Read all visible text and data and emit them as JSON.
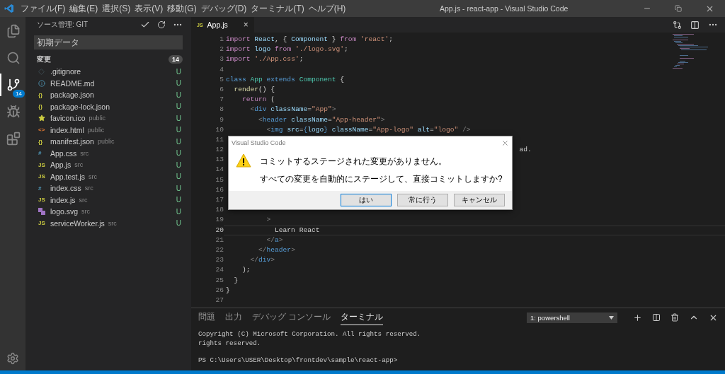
{
  "window": {
    "title": "App.js - react-app - Visual Studio Code"
  },
  "menu": [
    "ファイル(F)",
    "編集(E)",
    "選択(S)",
    "表示(V)",
    "移動(G)",
    "デバッグ(D)",
    "ターミナル(T)",
    "ヘルプ(H)"
  ],
  "activity_bar": [
    {
      "kind": "files",
      "selected": false
    },
    {
      "kind": "search",
      "selected": false
    },
    {
      "kind": "scm",
      "selected": true,
      "badge": "14"
    },
    {
      "kind": "debug",
      "selected": false
    },
    {
      "kind": "extensions",
      "selected": false
    }
  ],
  "sidebar": {
    "title": "ソース管理: GIT",
    "commit_message": "初期データ",
    "section": {
      "label": "変更",
      "count": "14"
    },
    "files": [
      {
        "kind": "git",
        "name": ".gitignore",
        "status": "U"
      },
      {
        "kind": "info",
        "name": "README.md",
        "status": "U"
      },
      {
        "kind": "json",
        "glyph": "{}",
        "name": "package.json",
        "status": "U"
      },
      {
        "kind": "json",
        "glyph": "{}",
        "name": "package-lock.json",
        "status": "U"
      },
      {
        "kind": "star",
        "name": "favicon.ico",
        "folder": "public",
        "status": "U"
      },
      {
        "kind": "html",
        "glyph": "<>",
        "name": "index.html",
        "folder": "public",
        "status": "U"
      },
      {
        "kind": "json",
        "glyph": "{}",
        "name": "manifest.json",
        "folder": "public",
        "status": "U"
      },
      {
        "kind": "css",
        "glyph": "#",
        "name": "App.css",
        "folder": "src",
        "status": "U"
      },
      {
        "kind": "js",
        "glyph": "JS",
        "name": "App.js",
        "folder": "src",
        "status": "U"
      },
      {
        "kind": "js",
        "glyph": "JS",
        "name": "App.test.js",
        "folder": "src",
        "status": "U"
      },
      {
        "kind": "css",
        "glyph": "#",
        "name": "index.css",
        "folder": "src",
        "status": "U"
      },
      {
        "kind": "js",
        "glyph": "JS",
        "name": "index.js",
        "folder": "src",
        "status": "U"
      },
      {
        "kind": "svg",
        "name": "logo.svg",
        "folder": "src",
        "status": "U"
      },
      {
        "kind": "js",
        "glyph": "JS",
        "name": "serviceWorker.js",
        "folder": "src",
        "status": "U"
      }
    ]
  },
  "tabs": [
    {
      "glyph": "JS",
      "label": "App.js",
      "close": "×",
      "selected": true
    }
  ],
  "editor": {
    "lines": [
      {
        "number": "1",
        "current": false,
        "tokens": [
          {
            "kind": "kw",
            "t": "import "
          },
          {
            "kind": "var",
            "t": "React"
          },
          {
            "kind": "p",
            "t": ", { "
          },
          {
            "kind": "var",
            "t": "Component"
          },
          {
            "kind": "p",
            "t": " } "
          },
          {
            "kind": "kw",
            "t": "from "
          },
          {
            "kind": "str",
            "t": "'react'"
          },
          {
            "kind": "p",
            "t": ";"
          }
        ]
      },
      {
        "number": "2",
        "current": false,
        "tokens": [
          {
            "kind": "kw",
            "t": "import "
          },
          {
            "kind": "var",
            "t": "logo "
          },
          {
            "kind": "kw",
            "t": "from "
          },
          {
            "kind": "str",
            "t": "'./logo.svg'"
          },
          {
            "kind": "p",
            "t": ";"
          }
        ]
      },
      {
        "number": "3",
        "current": false,
        "tokens": [
          {
            "kind": "kw",
            "t": "import "
          },
          {
            "kind": "str",
            "t": "'./App.css'"
          },
          {
            "kind": "p",
            "t": ";"
          }
        ]
      },
      {
        "number": "4",
        "current": false
      },
      {
        "number": "5",
        "current": false,
        "tokens": [
          {
            "kind": "decl",
            "t": "class "
          },
          {
            "kind": "type",
            "t": "App "
          },
          {
            "kind": "decl",
            "t": "extends "
          },
          {
            "kind": "type",
            "t": "Component "
          },
          {
            "kind": "p",
            "t": "{"
          }
        ]
      },
      {
        "number": "6",
        "current": false,
        "tokens": [
          {
            "kind": "fn",
            "t": "  render"
          },
          {
            "kind": "p",
            "t": "() {"
          }
        ]
      },
      {
        "number": "7",
        "current": false,
        "tokens": [
          {
            "kind": "kw",
            "t": "    return "
          },
          {
            "kind": "p",
            "t": "("
          }
        ]
      },
      {
        "number": "8",
        "current": false,
        "tokens": [
          {
            "kind": "tag",
            "t": "      <"
          },
          {
            "kind": "decl",
            "t": "div "
          },
          {
            "kind": "var",
            "t": "className"
          },
          {
            "kind": "p",
            "t": "="
          },
          {
            "kind": "str",
            "t": "\"App\""
          },
          {
            "kind": "tag",
            "t": ">"
          }
        ]
      },
      {
        "number": "9",
        "current": false,
        "tokens": [
          {
            "kind": "tag",
            "t": "        <"
          },
          {
            "kind": "decl",
            "t": "header "
          },
          {
            "kind": "var",
            "t": "className"
          },
          {
            "kind": "p",
            "t": "="
          },
          {
            "kind": "str",
            "t": "\"App-header\""
          },
          {
            "kind": "tag",
            "t": ">"
          }
        ]
      },
      {
        "number": "10",
        "current": false,
        "tokens": [
          {
            "kind": "tag",
            "t": "          <"
          },
          {
            "kind": "decl",
            "t": "img "
          },
          {
            "kind": "var",
            "t": "src"
          },
          {
            "kind": "p",
            "t": "="
          },
          {
            "kind": "decl",
            "t": "{"
          },
          {
            "kind": "var",
            "t": "logo"
          },
          {
            "kind": "decl",
            "t": "} "
          },
          {
            "kind": "var",
            "t": "className"
          },
          {
            "kind": "p",
            "t": "="
          },
          {
            "kind": "str",
            "t": "\"App-logo\" "
          },
          {
            "kind": "var",
            "t": "alt"
          },
          {
            "kind": "p",
            "t": "="
          },
          {
            "kind": "str",
            "t": "\"logo\" "
          },
          {
            "kind": "tag",
            "t": "/>"
          }
        ]
      },
      {
        "number": "11",
        "current": false
      },
      {
        "number": "12",
        "current": false,
        "tokens": [
          {
            "kind": "p",
            "t": "                                                                        ad."
          }
        ]
      },
      {
        "number": "13",
        "current": false
      },
      {
        "number": "14",
        "current": false
      },
      {
        "number": "15",
        "current": false
      },
      {
        "number": "16",
        "current": false
      },
      {
        "number": "17",
        "current": false
      },
      {
        "number": "18",
        "current": false
      },
      {
        "number": "19",
        "current": false,
        "tokens": [
          {
            "kind": "tag",
            "t": "          >"
          }
        ]
      },
      {
        "number": "20",
        "current": true,
        "tokens": [
          {
            "kind": "p",
            "t": "            Learn React"
          }
        ]
      },
      {
        "number": "21",
        "current": false,
        "tokens": [
          {
            "kind": "tag",
            "t": "          </"
          },
          {
            "kind": "decl",
            "t": "a"
          },
          {
            "kind": "tag",
            "t": ">"
          }
        ]
      },
      {
        "number": "22",
        "current": false,
        "tokens": [
          {
            "kind": "tag",
            "t": "        </"
          },
          {
            "kind": "decl",
            "t": "header"
          },
          {
            "kind": "tag",
            "t": ">"
          }
        ]
      },
      {
        "number": "23",
        "current": false,
        "tokens": [
          {
            "kind": "tag",
            "t": "      </"
          },
          {
            "kind": "decl",
            "t": "div"
          },
          {
            "kind": "tag",
            "t": ">"
          }
        ]
      },
      {
        "number": "24",
        "current": false,
        "tokens": [
          {
            "kind": "p",
            "t": "    );"
          }
        ]
      },
      {
        "number": "25",
        "current": false,
        "tokens": [
          {
            "kind": "p",
            "t": "  }"
          }
        ]
      },
      {
        "number": "26",
        "current": false,
        "tokens": [
          {
            "kind": "p",
            "t": "}"
          }
        ]
      },
      {
        "number": "27",
        "current": false
      }
    ]
  },
  "dialog": {
    "title": "Visual Studio Code",
    "messages": [
      "コミットするステージされた変更がありません。",
      "すべての変更を自動的にステージして、直接コミットしますか?"
    ],
    "buttons": [
      {
        "label": "はい",
        "default": true
      },
      {
        "label": "常に行う",
        "default": false
      },
      {
        "label": "キャンセル",
        "default": false
      }
    ]
  },
  "panel": {
    "tabs": [
      {
        "label": "問題",
        "selected": false
      },
      {
        "label": "出力",
        "selected": false
      },
      {
        "label": "デバッグ コンソール",
        "selected": false
      },
      {
        "label": "ターミナル",
        "selected": true
      }
    ],
    "terminal_select": "1: powershell",
    "terminal_lines": [
      "Copyright (C) Microsoft Corporation. All rights reserved.",
      "rights reserved.",
      "PS C:\\Users\\USER\\Desktop\\frontdev\\sample\\react-app>"
    ]
  }
}
